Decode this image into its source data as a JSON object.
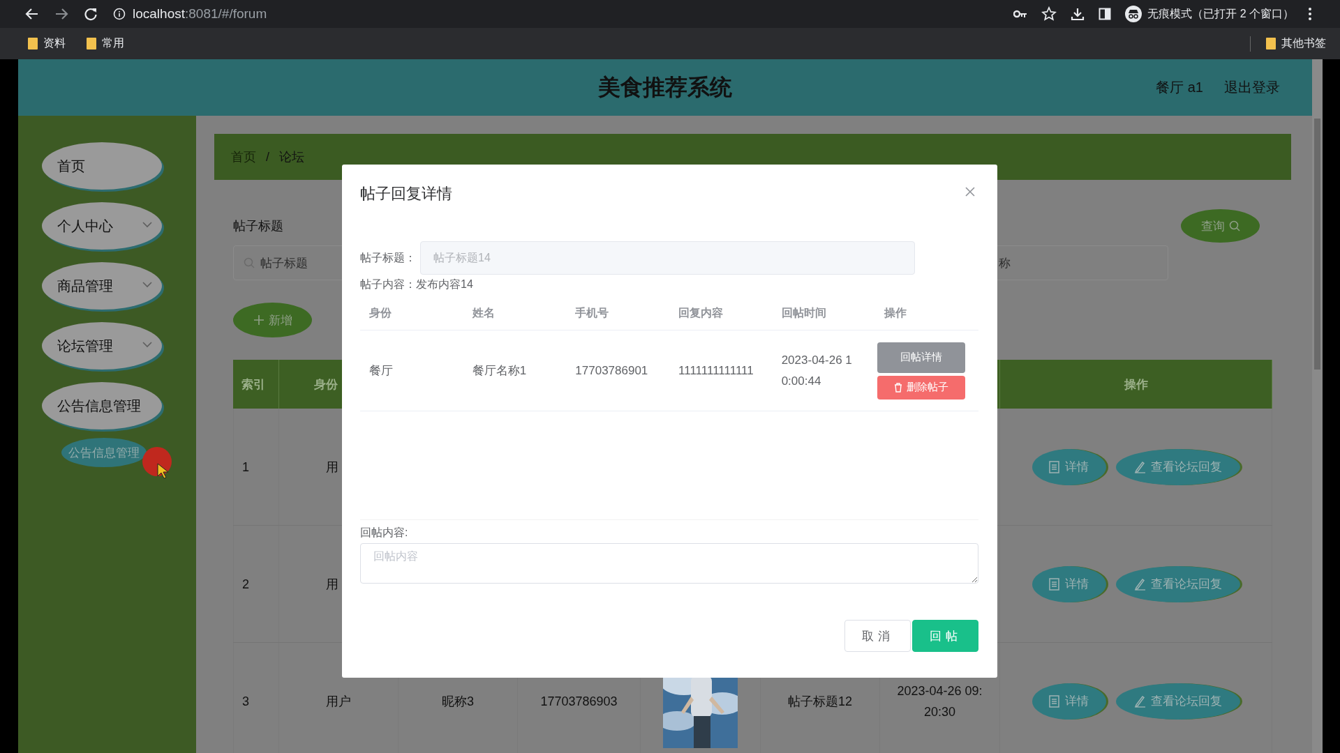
{
  "browser": {
    "url_host": "localhost",
    "url_path": ":8081/#/forum",
    "profile_label": "无痕模式（已打开 2 个窗口）",
    "bookmarks": [
      "资料",
      "常用"
    ],
    "other_bookmarks": "其他书签"
  },
  "header": {
    "title": "美食推荐系统",
    "user": "餐厅 a1",
    "logout": "退出登录"
  },
  "sidebar": {
    "items": [
      {
        "label": "首页",
        "chevron": false
      },
      {
        "label": "个人中心",
        "chevron": true
      },
      {
        "label": "商品管理",
        "chevron": true
      },
      {
        "label": "论坛管理",
        "chevron": true
      },
      {
        "label": "公告信息管理",
        "chevron": false,
        "children": [
          {
            "label": "公告信息管理"
          }
        ]
      }
    ]
  },
  "breadcrumb": {
    "items": [
      "首页",
      "论坛"
    ],
    "separator": "/"
  },
  "search": {
    "label": "帖子标题",
    "placeholder": "帖子标题",
    "second_placeholder": "称",
    "query_button": "查询",
    "add_button": "新增"
  },
  "table": {
    "columns": [
      "索引",
      "身份",
      "操作"
    ],
    "rows": [
      {
        "cells": [
          {
            "kind": "text",
            "text": "1"
          },
          {
            "kind": "text",
            "text": "用"
          }
        ],
        "actions": [
          "详情",
          "查看论坛回复"
        ]
      },
      {
        "cells": [
          {
            "kind": "text",
            "text": "2"
          },
          {
            "kind": "text",
            "text": "用"
          }
        ],
        "actions": [
          "详情",
          "查看论坛回复"
        ]
      },
      {
        "cells": [
          {
            "kind": "text",
            "text": "3"
          },
          {
            "kind": "text",
            "text": "用户"
          },
          {
            "kind": "text",
            "text": "昵称3"
          },
          {
            "kind": "text",
            "text": "17703786903"
          },
          {
            "kind": "picture"
          },
          {
            "kind": "text",
            "text": "帖子标题12"
          },
          {
            "kind": "text",
            "text": "2023-04-26 09:20:30"
          }
        ],
        "actions": [
          "详情",
          "查看论坛回复"
        ]
      }
    ]
  },
  "modal": {
    "title": "帖子回复详情",
    "title_label": "帖子标题：",
    "title_value": "帖子标题14",
    "content_label": "帖子内容：",
    "content_value": "发布内容14",
    "columns": [
      "身份",
      "姓名",
      "手机号",
      "回复内容",
      "回帖时间",
      "操作"
    ],
    "rows": [
      {
        "cells": [
          "餐厅",
          "餐厅名称1",
          "17703786901",
          "1111111111111",
          "2023-04-26 10:00:44"
        ],
        "actions": [
          {
            "label": "回帖详情",
            "kind": "info"
          },
          {
            "label": "删除帖子",
            "kind": "danger"
          }
        ]
      }
    ],
    "reply_label": "回帖内容:",
    "reply_placeholder": "回帖内容",
    "buttons": [
      {
        "label": "取消",
        "kind": "default"
      },
      {
        "label": "回帖",
        "kind": "primary"
      }
    ]
  }
}
